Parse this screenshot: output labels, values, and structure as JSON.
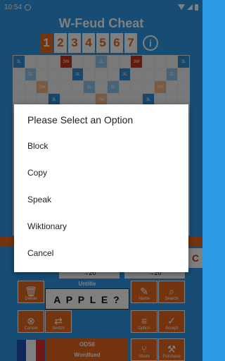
{
  "status_bar": {
    "time": "10:54"
  },
  "app": {
    "title": "W-Feud Cheat"
  },
  "page_tabs": [
    "1",
    "2",
    "3",
    "4",
    "5",
    "6",
    "7"
  ],
  "info_icon": "i",
  "board_labels": {
    "tl": "3L",
    "dl": "2L",
    "tw": "3W",
    "dw": "2W"
  },
  "scores": {
    "left": "→20",
    "right": "→20"
  },
  "side_tile": "C",
  "tools": {
    "delete": "Delete",
    "name": "Name",
    "search": "Search",
    "cancel": "Cancel",
    "switch": "Switch",
    "option": "Option",
    "accept": "Accept",
    "share": "Share",
    "purchase": "Purchase"
  },
  "rack": {
    "title": "Untitle",
    "word": "A P P L E ?"
  },
  "dictionary": {
    "code": "ODS8",
    "game": "Wordfued"
  },
  "dialog": {
    "title": "Please Select an Option",
    "options": [
      "Block",
      "Copy",
      "Speak",
      "Wiktionary",
      "Cancel"
    ]
  },
  "colors": {
    "primary": "#2f9ae8",
    "accent": "#e8691f",
    "tw": "#c8321e",
    "tl": "#2f8fd6",
    "dl": "#8fc7ee",
    "dw": "#f3b584"
  }
}
